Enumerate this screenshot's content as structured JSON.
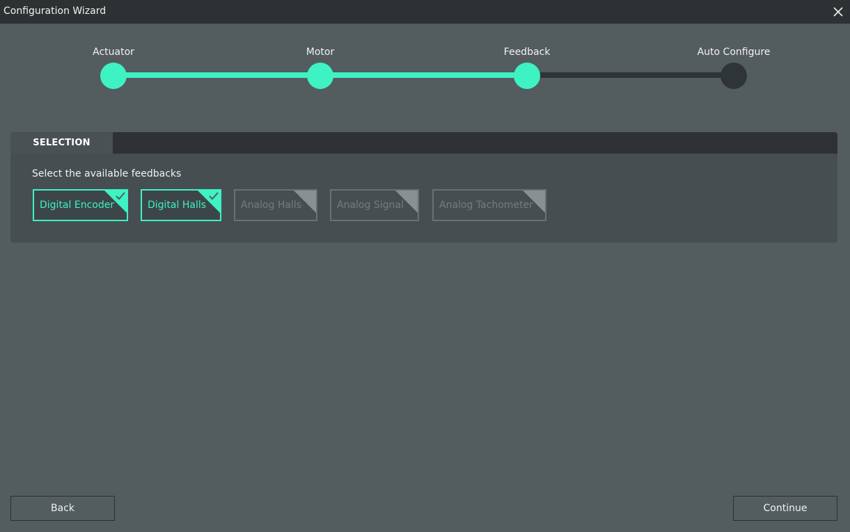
{
  "window": {
    "title": "Configuration Wizard",
    "close_icon": "close-icon"
  },
  "colors": {
    "accent": "#3ef2c4",
    "inactive": "#2f3436",
    "background": "#535c5f",
    "titlebar": "#2c3234"
  },
  "wizard": {
    "steps": [
      {
        "label": "Actuator",
        "status": "done"
      },
      {
        "label": "Motor",
        "status": "done"
      },
      {
        "label": "Feedback",
        "status": "current"
      },
      {
        "label": "Auto Configure",
        "status": "pending"
      }
    ]
  },
  "selection": {
    "tab_label": "SELECTION",
    "instruction": "Select the available feedbacks",
    "options": [
      {
        "label": "Digital Encoder",
        "selected": true
      },
      {
        "label": "Digital Halls",
        "selected": true
      },
      {
        "label": "Analog Halls",
        "selected": false
      },
      {
        "label": "Analog Signal",
        "selected": false
      },
      {
        "label": "Analog Tachometer",
        "selected": false
      }
    ]
  },
  "footer": {
    "back_label": "Back",
    "continue_label": "Continue"
  }
}
